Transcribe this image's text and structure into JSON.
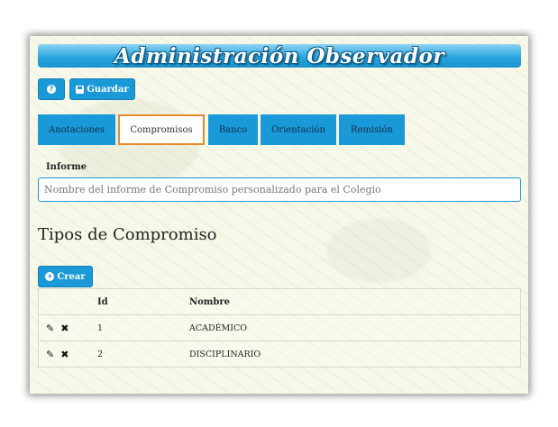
{
  "header": {
    "title": "Administración Observador"
  },
  "toolbar": {
    "help_icon_label": "?",
    "save_label": "Guardar"
  },
  "tabs": [
    {
      "label": "Anotaciones",
      "active": false
    },
    {
      "label": "Compromisos",
      "active": true
    },
    {
      "label": "Banco",
      "active": false
    },
    {
      "label": "Orientación",
      "active": false
    },
    {
      "label": "Remisión",
      "active": false
    }
  ],
  "informe": {
    "label": "Informe",
    "value": "",
    "placeholder": "Nombre del informe de Compromiso personalizado para el Colegio"
  },
  "section": {
    "title": "Tipos de Compromiso",
    "create_label": "Crear"
  },
  "table": {
    "columns": [
      "",
      "Id",
      "Nombre"
    ],
    "rows": [
      {
        "id": "1",
        "name": "ACADÉMICO"
      },
      {
        "id": "2",
        "name": "DISCIPLINARIO"
      }
    ]
  },
  "icons": {
    "help": "question-circle-icon",
    "save": "floppy-disk-icon",
    "create": "plus-circle-icon",
    "edit": "pencil-icon",
    "delete": "close-icon"
  },
  "colors": {
    "accent": "#1a99d8",
    "active_tab_border": "#e8892c"
  }
}
